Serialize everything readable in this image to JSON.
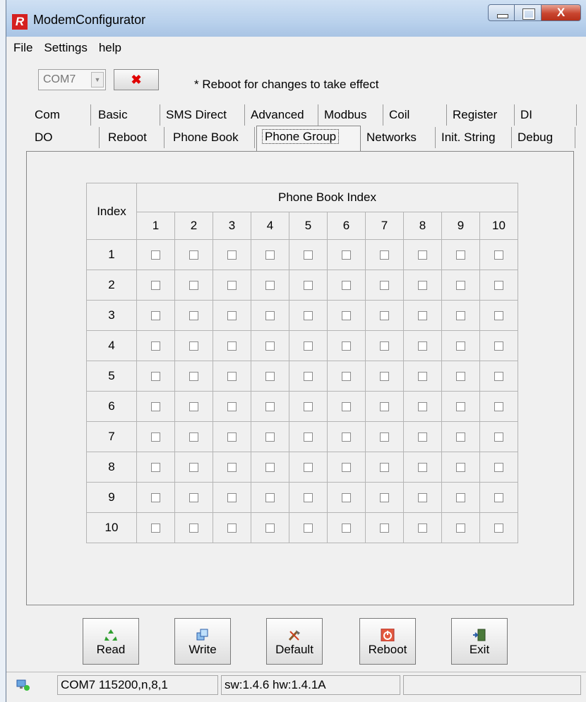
{
  "window": {
    "title": "ModemConfigurator",
    "app_icon_letter": "R",
    "close_glyph": "X"
  },
  "menu": [
    "File",
    "Settings",
    "help"
  ],
  "toolbar": {
    "com_port": "COM7",
    "disconnect_glyph": "✖",
    "notice": "* Reboot for changes to take effect"
  },
  "tabs_row1": [
    "Com",
    "Basic",
    "SMS Direct",
    "Advanced",
    "Modbus",
    "Coil",
    "Register",
    "DI"
  ],
  "tabs_row2": [
    "DO",
    "Reboot",
    "Phone Book",
    "Phone Group",
    "Networks",
    "Init. String",
    "Debug"
  ],
  "active_tab": "Phone Group",
  "grid": {
    "index_header": "Index",
    "group_header": "Phone Book Index",
    "columns": [
      "1",
      "2",
      "3",
      "4",
      "5",
      "6",
      "7",
      "8",
      "9",
      "10"
    ],
    "rows": [
      "1",
      "2",
      "3",
      "4",
      "5",
      "6",
      "7",
      "8",
      "9",
      "10"
    ],
    "all_checked": false
  },
  "buttons": {
    "read": "Read",
    "write": "Write",
    "default": "Default",
    "reboot": "Reboot",
    "exit": "Exit"
  },
  "status": {
    "connection": "COM7 115200,n,8,1",
    "version": "sw:1.4.6 hw:1.4.1A",
    "extra": ""
  },
  "colors": {
    "accent_close": "#c9452f",
    "red_x": "#e00000",
    "title_bar": "#b9d1ec"
  }
}
